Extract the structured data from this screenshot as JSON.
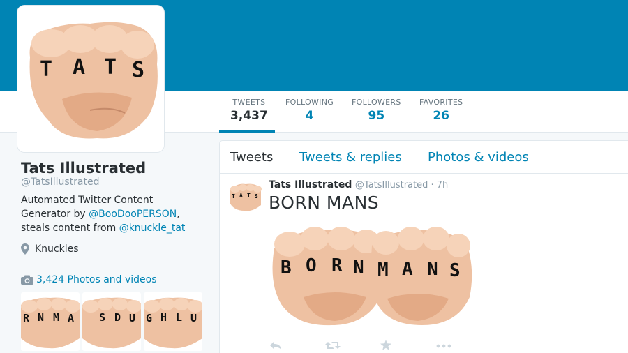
{
  "profile": {
    "name": "Tats Illustrated",
    "handle": "@TatsIllustrated",
    "bio_line1": "Automated Twitter Content",
    "bio_line2_prefix": "Generator by ",
    "bio_link1": "@BooDooPERSON",
    "bio_line2_suffix": ",",
    "bio_line3_prefix": "steals content from ",
    "bio_link2": "@knuckle_tat",
    "location": "Knuckles",
    "photos_label": "3,424 Photos and videos",
    "avatar_letters": [
      "T",
      "A",
      "T",
      "S"
    ]
  },
  "stats": [
    {
      "label": "TWEETS",
      "value": "3,437"
    },
    {
      "label": "FOLLOWING",
      "value": "4"
    },
    {
      "label": "FOLLOWERS",
      "value": "95"
    },
    {
      "label": "FAVORITES",
      "value": "26"
    }
  ],
  "tabs": [
    "Tweets",
    "Tweets & replies",
    "Photos & videos"
  ],
  "tweet": {
    "author": "Tats Illustrated",
    "meta": "@TatsIllustrated · 7h",
    "text": "BORN MANS",
    "media_letters_left": [
      "B",
      "O",
      "R",
      "N"
    ],
    "media_letters_right": [
      "M",
      "A",
      "N",
      "S"
    ],
    "avatar_letters": [
      "T",
      "A",
      "T",
      "S"
    ]
  },
  "thumbnails": [
    {
      "letters": [
        "R",
        "N",
        "M",
        "A"
      ]
    },
    {
      "letters": [
        "S",
        "D",
        "U",
        ""
      ]
    },
    {
      "letters": [
        "G",
        "H",
        "L",
        "U"
      ]
    }
  ],
  "colors": {
    "banner": "#0084b4",
    "link": "#0084b4",
    "skin": "#f0bf9c"
  },
  "icons": {
    "location": "map-pin-icon",
    "photos": "camera-icon",
    "reply": "reply-icon",
    "retweet": "retweet-icon",
    "favorite": "star-icon",
    "more": "more-icon"
  }
}
